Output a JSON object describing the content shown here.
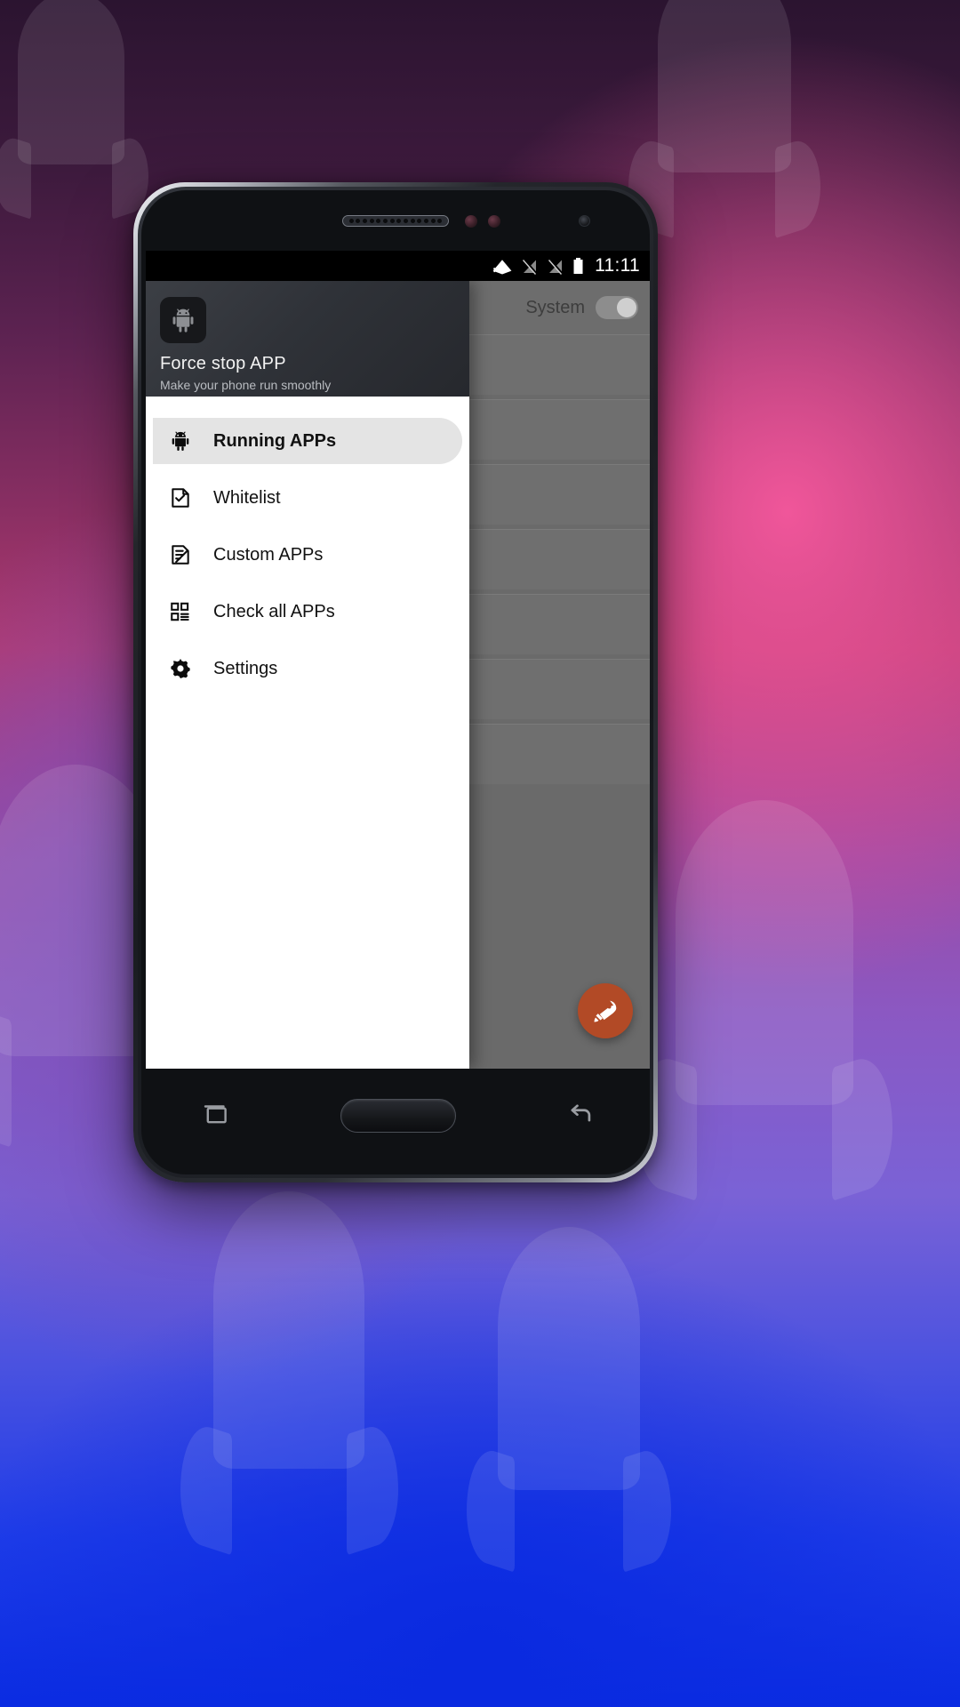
{
  "wallpaper": {
    "description": "gradient-rocket-wallpaper",
    "colors": [
      "#2b1430",
      "#b23a71",
      "#8a59c4",
      "#0a2ce2"
    ]
  },
  "status_bar": {
    "time": "11:11",
    "icons": [
      "wifi-icon",
      "signal-no-sim-icon",
      "signal-no-sim-icon",
      "battery-icon"
    ]
  },
  "drawer": {
    "app_icon": "android-robot-icon",
    "title": "Force stop APP",
    "subtitle": "Make your phone run smoothly",
    "items": [
      {
        "label": "Running APPs",
        "icon": "android-robot-icon",
        "active": true
      },
      {
        "label": "Whitelist",
        "icon": "document-check-icon",
        "active": false
      },
      {
        "label": "Custom APPs",
        "icon": "document-edit-icon",
        "active": false
      },
      {
        "label": "Check all APPs",
        "icon": "grid-list-icon",
        "active": false
      },
      {
        "label": "Settings",
        "icon": "gear-icon",
        "active": false
      }
    ]
  },
  "app_background": {
    "system_toggle_label": "System",
    "system_toggle_on": false,
    "cards": [
      {
        "icon": "shield-plus-icon"
      },
      {
        "icon": "shield-plus-icon"
      },
      {
        "icon": "shield-plus-icon"
      },
      {
        "icon": "shield-plus-icon"
      },
      {
        "icon": "shield-plus-icon"
      },
      {
        "icon": "shield-plus-icon"
      },
      {
        "icon": "shield-plus-icon"
      }
    ],
    "fab": {
      "icon": "rocket-icon",
      "color": "#b24a26"
    }
  },
  "nav_bar": {
    "buttons": [
      "recents-button",
      "home-button",
      "back-button"
    ]
  }
}
